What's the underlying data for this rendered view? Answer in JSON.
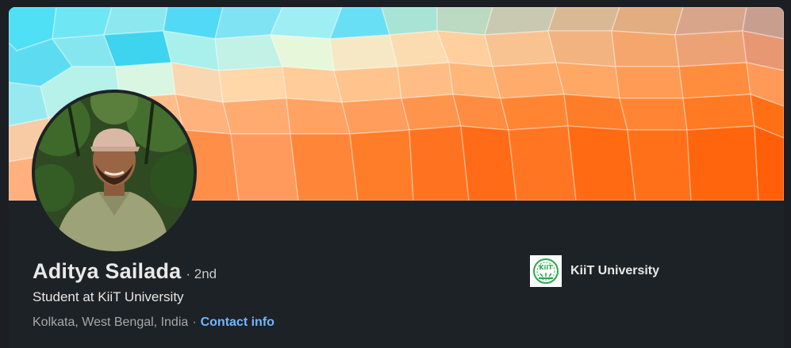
{
  "profile": {
    "name": "Aditya Sailada",
    "degree": "· 2nd",
    "headline": "Student at KiiT University",
    "location": "Kolkata, West Bengal, India",
    "location_separator": "·",
    "contact_link": "Contact info"
  },
  "education": {
    "name": "KiiT University",
    "logo_icon": "kiit-university-logo"
  },
  "colors": {
    "background": "#1d2226",
    "link": "#71b7fb",
    "banner_cyan": "#62def0",
    "banner_orange": "#ff7a1f"
  }
}
